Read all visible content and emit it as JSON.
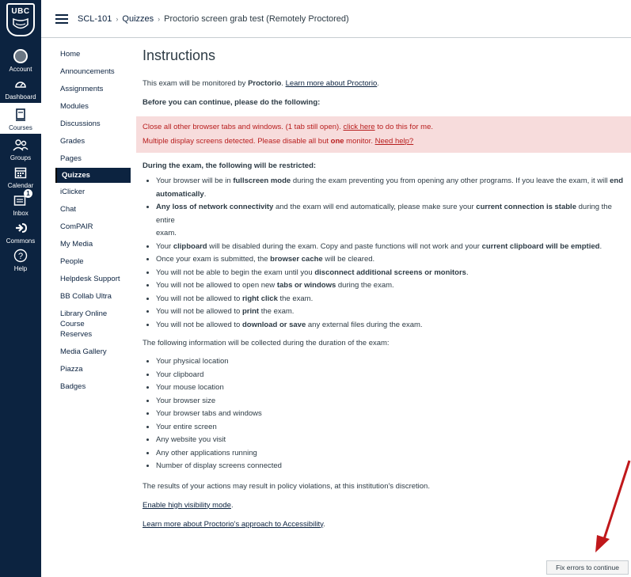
{
  "global_nav": {
    "logo_text": "UBC",
    "items": [
      {
        "label": "Account",
        "icon": "account-icon"
      },
      {
        "label": "Dashboard",
        "icon": "dashboard-icon"
      },
      {
        "label": "Courses",
        "icon": "courses-icon"
      },
      {
        "label": "Groups",
        "icon": "groups-icon"
      },
      {
        "label": "Calendar",
        "icon": "calendar-icon"
      },
      {
        "label": "Inbox",
        "icon": "inbox-icon",
        "badge": "1"
      },
      {
        "label": "Commons",
        "icon": "commons-icon"
      },
      {
        "label": "Help",
        "icon": "help-icon"
      }
    ]
  },
  "breadcrumb": {
    "course": "SCL-101",
    "section": "Quizzes",
    "current": "Proctorio screen grab test (Remotely Proctored)"
  },
  "course_nav": [
    "Home",
    "Announcements",
    "Assignments",
    "Modules",
    "Discussions",
    "Grades",
    "Pages",
    "Quizzes",
    "iClicker",
    "Chat",
    "ComPAIR",
    "My Media",
    "People",
    "Helpdesk Support",
    "BB Collab Ultra",
    "Library Online Course Reserves",
    "Media Gallery",
    "Piazza",
    "Badges"
  ],
  "main": {
    "title": "Instructions",
    "monitor_prefix": "This exam will be monitored by ",
    "monitor_brand": "Proctorio",
    "monitor_suffix": ". ",
    "monitor_link": "Learn more about Proctorio",
    "monitor_end": ".",
    "before_heading": "Before you can continue, please do the following:",
    "alert1_prefix": "Close all other browser tabs and windows. (1 tab still open). ",
    "alert1_link": "click here",
    "alert1_suffix": " to do this for me.",
    "alert2_prefix": "Multiple display screens detected. Please disable all but ",
    "alert2_bold": "one",
    "alert2_mid": " monitor. ",
    "alert2_link": "Need help?",
    "restricted_heading": "During the exam, the following will be restricted:",
    "r1_a": "Your browser will be in ",
    "r1_b": "fullscreen mode",
    "r1_c": " during the exam preventing you from opening any other programs. If you leave the exam, it will ",
    "r1_d": "end",
    "r1_e": "automatically",
    "r1_f": ".",
    "r2_a": "Any loss of network connectivity",
    "r2_b": " and the exam will end automatically, please make sure your ",
    "r2_c": "current connection is stable",
    "r2_d": " during the entire",
    "r2_e": "exam.",
    "r3_a": "Your ",
    "r3_b": "clipboard",
    "r3_c": " will be disabled during the exam. Copy and paste functions will not work and your ",
    "r3_d": "current clipboard will be emptied",
    "r3_e": ".",
    "r4_a": "Once your exam is submitted, the ",
    "r4_b": "browser cache",
    "r4_c": " will be cleared.",
    "r5_a": "You will not be able to begin the exam until you ",
    "r5_b": "disconnect additional screens or monitors",
    "r5_c": ".",
    "r6_a": "You will not be allowed to open new ",
    "r6_b": "tabs or windows",
    "r6_c": " during the exam.",
    "r7_a": "You will not be allowed to ",
    "r7_b": "right click",
    "r7_c": " the exam.",
    "r8_a": "You will not be allowed to ",
    "r8_b": "print",
    "r8_c": " the exam.",
    "r9_a": "You will not be allowed to ",
    "r9_b": "download or save",
    "r9_c": " any external files during the exam.",
    "collected_heading": "The following information will be collected during the duration of the exam:",
    "collected": [
      "Your physical location",
      "Your clipboard",
      "Your mouse location",
      "Your browser size",
      "Your browser tabs and windows",
      "Your entire screen",
      "Any website you visit",
      "Any other applications running",
      "Number of display screens connected"
    ],
    "policy_text": "The results of your actions may result in policy violations, at this institution's discretion.",
    "high_visibility_link": "Enable high visibility mode",
    "high_visibility_end": ".",
    "accessibility_link": "Learn more about Proctorio's approach to Accessibility",
    "accessibility_end": "."
  },
  "footer": {
    "fix_button": "Fix errors to continue"
  },
  "colors": {
    "nav_bg": "#0c2340",
    "alert_bg": "#f7dcdc",
    "alert_text": "#b81e1e",
    "arrow": "#c0181b"
  }
}
